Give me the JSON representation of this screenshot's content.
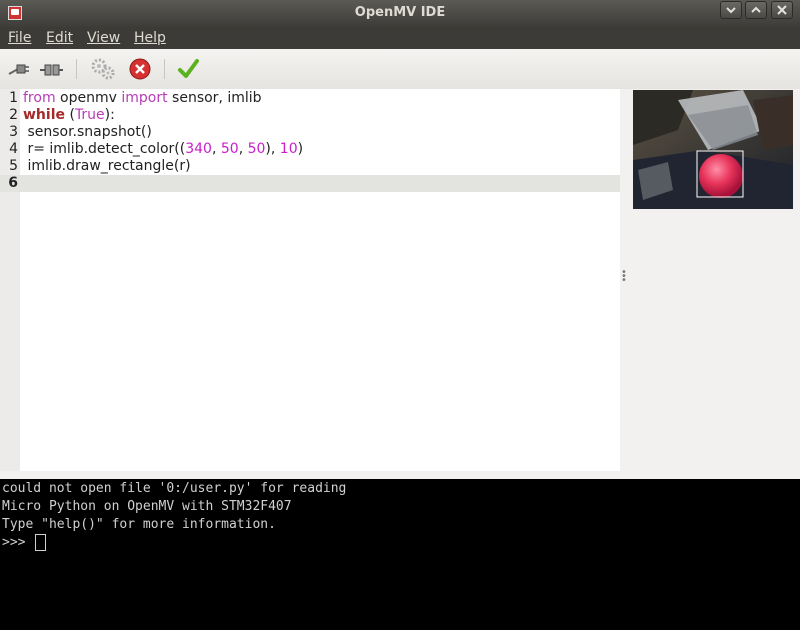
{
  "window": {
    "title": "OpenMV IDE",
    "controls": [
      "minimize",
      "maximize",
      "close"
    ]
  },
  "menu": {
    "items": [
      {
        "label": "File",
        "mnemonic": "F"
      },
      {
        "label": "Edit",
        "mnemonic": "E"
      },
      {
        "label": "View",
        "mnemonic": "V"
      },
      {
        "label": "Help",
        "mnemonic": "H"
      }
    ]
  },
  "toolbar": {
    "buttons": [
      {
        "name": "connect-icon",
        "state": "enabled"
      },
      {
        "name": "disconnect-icon",
        "state": "enabled"
      },
      {
        "name": "settings-gears-icon",
        "state": "disabled"
      },
      {
        "name": "stop-icon",
        "state": "enabled",
        "color": "#d32f2f"
      },
      {
        "name": "run-check-icon",
        "state": "enabled",
        "color": "#4caf20"
      }
    ]
  },
  "editor": {
    "lines": [
      {
        "n": "1",
        "tokens": [
          {
            "t": "from",
            "c": "kw"
          },
          {
            "t": " openmv "
          },
          {
            "t": "import",
            "c": "kw"
          },
          {
            "t": " sensor, imlib"
          }
        ]
      },
      {
        "n": "2",
        "tokens": [
          {
            "t": "while",
            "c": "kw2"
          },
          {
            "t": " ("
          },
          {
            "t": "True",
            "c": "kw"
          },
          {
            "t": "):"
          }
        ]
      },
      {
        "n": "3",
        "tokens": [
          {
            "t": " sensor.snapshot()"
          }
        ]
      },
      {
        "n": "4",
        "tokens": [
          {
            "t": " r= imlib.detect_color(("
          },
          {
            "t": "340",
            "c": "num-lit"
          },
          {
            "t": ", "
          },
          {
            "t": "50",
            "c": "num-lit"
          },
          {
            "t": ", "
          },
          {
            "t": "50",
            "c": "num-lit"
          },
          {
            "t": "), "
          },
          {
            "t": "10",
            "c": "num-lit"
          },
          {
            "t": ")"
          }
        ]
      },
      {
        "n": "5",
        "tokens": [
          {
            "t": " imlib.draw_rectangle(r)"
          }
        ]
      },
      {
        "n": "6",
        "tokens": [],
        "current": true
      }
    ]
  },
  "terminal": {
    "lines": [
      "could not open file '0:/user.py' for reading",
      "Micro Python on OpenMV with STM32F407",
      "Type \"help()\" for more information."
    ],
    "prompt": ">>> "
  },
  "framebuffer": {
    "description_icon": "camera-preview-image",
    "detection_box_color": "#ffffff",
    "ball_color": "#e8345a"
  }
}
